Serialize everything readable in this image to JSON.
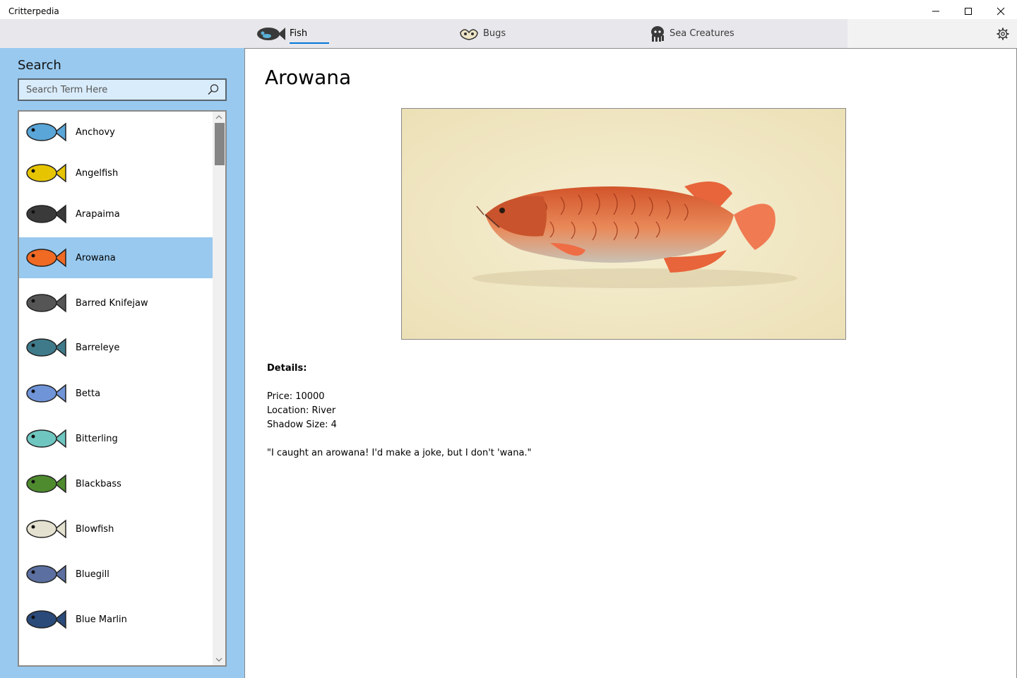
{
  "app": {
    "title": "Critterpedia"
  },
  "tabs": [
    {
      "label": "Fish",
      "icon": "fish-icon",
      "selected": true
    },
    {
      "label": "Bugs",
      "icon": "bug-icon",
      "selected": false
    },
    {
      "label": "Sea Creatures",
      "icon": "octopus-icon",
      "selected": false
    }
  ],
  "sidebar": {
    "heading": "Search",
    "search_placeholder": "Search Term Here",
    "search_value": "",
    "items": [
      {
        "name": "Anchovy",
        "selected": false,
        "color": "#5aa6d8"
      },
      {
        "name": "Angelfish",
        "selected": false,
        "color": "#e6c400"
      },
      {
        "name": "Arapaima",
        "selected": false,
        "color": "#3a3a3a"
      },
      {
        "name": "Arowana",
        "selected": true,
        "color": "#f06a24"
      },
      {
        "name": "Barred Knifejaw",
        "selected": false,
        "color": "#555555"
      },
      {
        "name": "Barreleye",
        "selected": false,
        "color": "#3f7a8a"
      },
      {
        "name": "Betta",
        "selected": false,
        "color": "#6f94d8"
      },
      {
        "name": "Bitterling",
        "selected": false,
        "color": "#6fc6c0"
      },
      {
        "name": "Blackbass",
        "selected": false,
        "color": "#4e8b2e"
      },
      {
        "name": "Blowfish",
        "selected": false,
        "color": "#e5e1d0"
      },
      {
        "name": "Bluegill",
        "selected": false,
        "color": "#5b6fa0"
      },
      {
        "name": "Blue Marlin",
        "selected": false,
        "color": "#2a4a7a"
      }
    ]
  },
  "detail": {
    "title": "Arowana",
    "details_label": "Details:",
    "price": "Price: 10000",
    "location": "Location: River",
    "shadow": "Shadow Size: 4",
    "quote": "\"I caught an arowana! I'd make a joke, but I don't 'wana.\""
  },
  "colors": {
    "accent": "#0078d7",
    "sidebar": "#99c9ef",
    "selected_row": "#99c9ef"
  }
}
